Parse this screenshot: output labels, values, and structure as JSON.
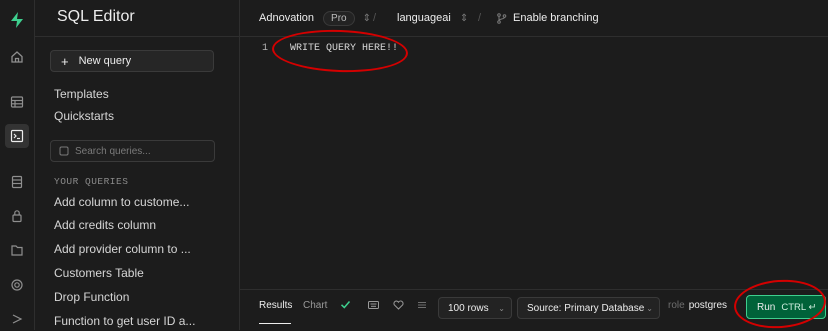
{
  "rail": {
    "icons": [
      "supabase-logo-icon",
      "home-icon",
      "table-editor-icon",
      "sql-editor-icon",
      "database-icon",
      "auth-lock-icon",
      "storage-icon",
      "realtime-icon",
      "edge-functions-icon"
    ]
  },
  "sidebar": {
    "title": "SQL Editor",
    "new_query_label": "New query",
    "nav": [
      "Templates",
      "Quickstarts"
    ],
    "search_placeholder": "Search queries...",
    "section_heading": "YOUR QUERIES",
    "queries": [
      "Add column to custome...",
      "Add credits column",
      "Add provider column to ...",
      "Customers Table",
      "Drop Function",
      "Function to get user ID a..."
    ]
  },
  "topbar": {
    "org": "Adnovation",
    "plan_badge": "Pro",
    "separator": "/",
    "project": "languageai",
    "branching_label": "Enable branching"
  },
  "editor": {
    "line_number": "1",
    "code": "WRITE QUERY HERE!!"
  },
  "bottombar": {
    "tab_results": "Results",
    "tab_chart": "Chart",
    "rows_select": "100 rows",
    "source_select": "Source: Primary Database",
    "role_label": "role",
    "role_value": "postgres",
    "run_label": "Run",
    "run_shortcut": "CTRL ↵"
  },
  "colors": {
    "accent": "#3ecf8e",
    "run_bg": "#006239",
    "annotation": "#d40000"
  }
}
